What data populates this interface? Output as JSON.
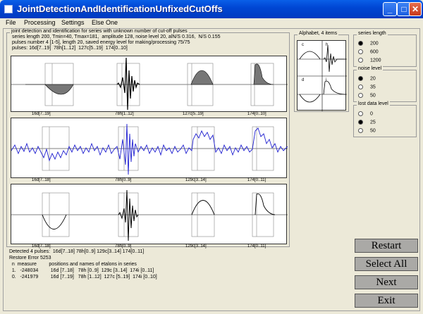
{
  "window": {
    "title": "JointDetectionAndIdentificationUnfixedCutOffs",
    "minimize": "_",
    "maximize": "□",
    "close": "✕"
  },
  "menu": [
    "File",
    "Processing",
    "Settings",
    "Else One"
  ],
  "main_group": {
    "caption": "joint detection and identification for series with unknown number of cut-off pulses",
    "line1": "series length 200, Tmin=40, Tmax=181,  amplitude 128, noise level 20, alN/S 0.316,  N/S 0.155",
    "line2": "pulses number 4 [1-5], length 20, saved energy level for making/processing 75/75",
    "line3": "pulses: 16d[7..19]  78h[1..12]  127c[5..19]  174[0..10]"
  },
  "panel1_labels": [
    "16d[7..19]",
    "78h[1..12]",
    "127c[5..19]",
    "174[0..10]"
  ],
  "panel2_labels": [
    "16d[7..18]",
    "78h[0..9]",
    "129c[3..14]",
    "174[0..11]"
  ],
  "panel3_labels": [
    "16d[7..18]",
    "78h[0..9]",
    "129c[3..14]",
    "174[0..11]"
  ],
  "alphabet": {
    "caption": "Alphabet, 4 items",
    "letters": [
      "c",
      "h",
      "d",
      "i"
    ]
  },
  "series_length": {
    "caption": "series length",
    "options": [
      "200",
      "600",
      "1200"
    ],
    "selected": 0
  },
  "noise_level": {
    "caption": "noise level",
    "options": [
      "20",
      "35",
      "50"
    ],
    "selected": 0
  },
  "lost_data": {
    "caption": "lost data level",
    "options": [
      "0",
      "25",
      "50"
    ],
    "selected": 1
  },
  "buttons": {
    "restart": "Restart",
    "select_all": "Select All",
    "next": "Next",
    "exit": "Exit"
  },
  "results": {
    "detected": "Detected 4 pulses:  16d[7..18] 78h[0..9] 129c[3..14] 174[0..11]",
    "restore": "Restore Error 5253",
    "header": "  n  measure         positions and names of etalons in series",
    "row1": "  1.   -248034         16d [7..18]   78h [0..9]  129c [3..14]  174i [0..11]",
    "row2": "  0.   -241979         16d [7..19]   78h [1..12]  127c [5..19]  174i [0..10]"
  }
}
